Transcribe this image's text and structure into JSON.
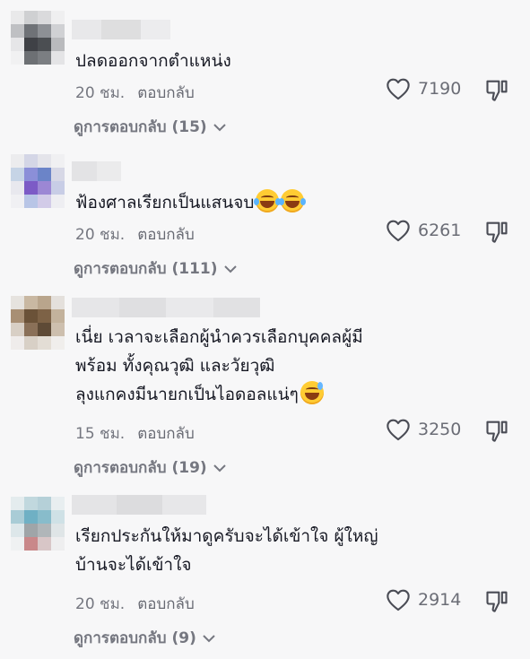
{
  "comments": [
    {
      "text_lines": [
        "ปลดออกจากตำแหน่ง"
      ],
      "time": "20 ชม.",
      "reply_label": "ตอบกลับ",
      "likes": "7190",
      "view_replies": "ดูการตอบกลับ (15)",
      "emoji": []
    },
    {
      "text_lines": [
        "ฟ้องศาลเรียกเป็นแสนจบ"
      ],
      "time": "20 ชม.",
      "reply_label": "ตอบกลับ",
      "likes": "6261",
      "view_replies": "ดูการตอบกลับ (111)",
      "emoji": [
        "face-with-tears-of-joy",
        "face-with-tears-of-joy"
      ]
    },
    {
      "text_lines": [
        "เนี่ย เวลาจะเลือกผู้นำควรเลือกบุคคลผู้มี",
        "พร้อม ทั้งคุณวุฒิ และวัยวุฒิ",
        "ลุงแกคงมีนายกเป็นไอดอลแน่ๆ"
      ],
      "time": "15 ชม.",
      "reply_label": "ตอบกลับ",
      "likes": "3250",
      "view_replies": "ดูการตอบกลับ (19)",
      "emoji": [
        "grinning-face-with-sweat"
      ]
    },
    {
      "text_lines": [
        "เรียกประกันให้มาดูครับจะได้เข้าใจ ผู้ใหญ่",
        "บ้านจะได้เข้าใจ"
      ],
      "time": "20 ชม.",
      "reply_label": "ตอบกลับ",
      "likes": "2914",
      "view_replies": "ดูการตอบกลับ (9)",
      "emoji": []
    }
  ],
  "icons": {
    "like": "heart-outline-icon",
    "dislike": "thumbs-down-icon",
    "expand": "chevron-down-icon"
  },
  "colors": {
    "background": "#f7f7f8",
    "text": "#161823",
    "secondary": "#757780"
  }
}
